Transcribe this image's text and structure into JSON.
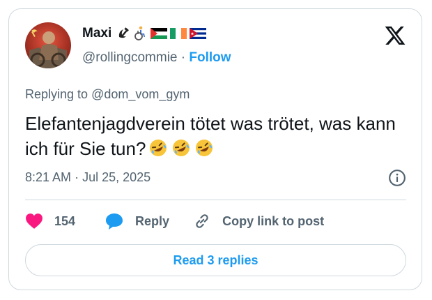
{
  "author": {
    "display_name": "Maxi",
    "handle": "@rollingcommie",
    "separator": "·",
    "follow_label": "Follow",
    "name_emojis": [
      "hammer-sickle",
      "wheelchair-person",
      "palestine-flag",
      "ireland-flag",
      "cuba-flag"
    ]
  },
  "reply_context": {
    "prefix": "Replying to",
    "mention": "@dom_vom_gym"
  },
  "tweet": {
    "text": "Elefantenjagdverein tötet was trötet, was kann ich für Sie tun?",
    "trailing_emoji": [
      "rolling-laughing",
      "rolling-laughing",
      "rolling-laughing"
    ],
    "time": "8:21 AM",
    "date": "Jul 25, 2025",
    "meta_separator": "·"
  },
  "actions": {
    "like_count": "154",
    "reply_label": "Reply",
    "copy_link_label": "Copy link to post"
  },
  "read_replies_label": "Read 3 replies",
  "colors": {
    "accent": "#1d9bf0",
    "like": "#f91880",
    "muted": "#536471",
    "border": "#cfd9de"
  }
}
